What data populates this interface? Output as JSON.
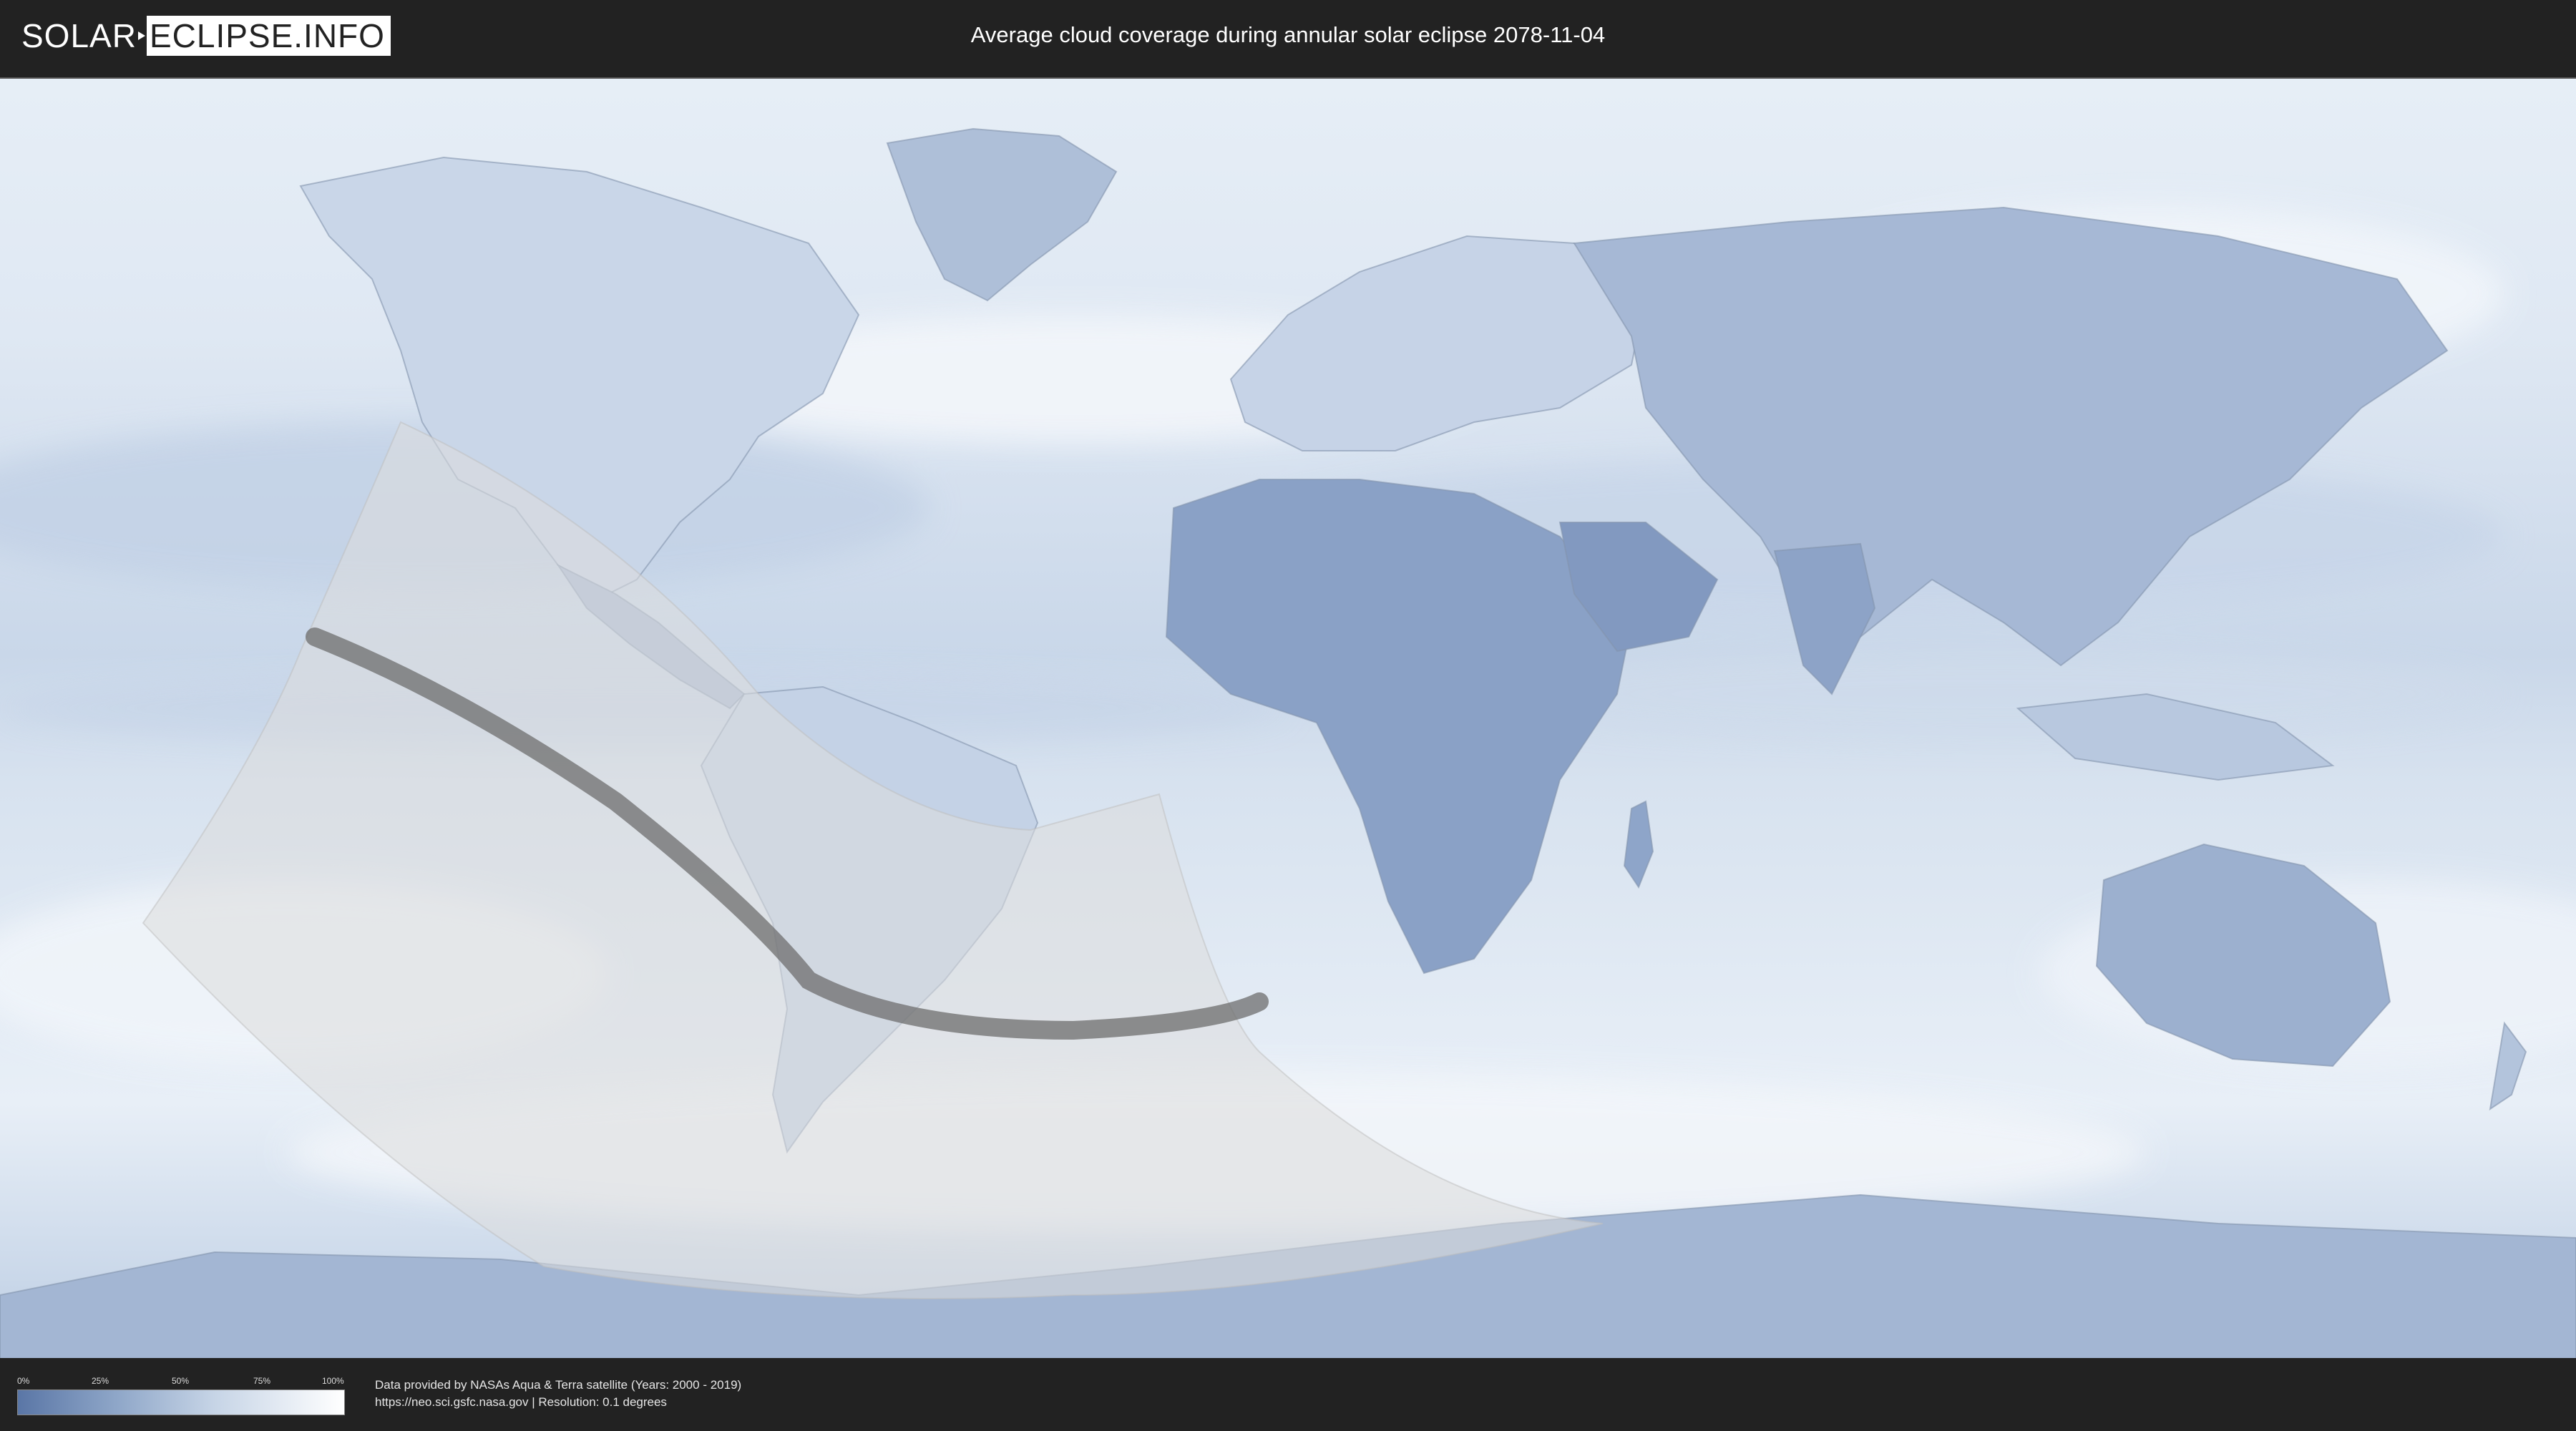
{
  "header": {
    "logo_left": "SOLAR",
    "logo_right": "ECLIPSE.INFO",
    "title": "Average cloud coverage during annular solar eclipse 2078-11-04"
  },
  "legend": {
    "ticks": [
      "0%",
      "25%",
      "50%",
      "75%",
      "100%"
    ],
    "colors": {
      "low": "#5a76a6",
      "high": "#ffffff"
    }
  },
  "footer": {
    "line1": "Data provided by NASAs Aqua & Terra satellite (Years: 2000 - 2019)",
    "line2": "https://neo.sci.gsfc.nasa.gov | Resolution: 0.1 degrees"
  },
  "map": {
    "projection": "equirectangular",
    "layers": [
      "cloud-coverage",
      "country-borders",
      "partial-eclipse-region",
      "annular-path"
    ],
    "colors": {
      "ocean_cloud": "#e4ecf5",
      "land_clear": "#7f97bf",
      "eclipse_overlay": "#d6d6d6",
      "annular_path": "#6e6e6e"
    }
  }
}
